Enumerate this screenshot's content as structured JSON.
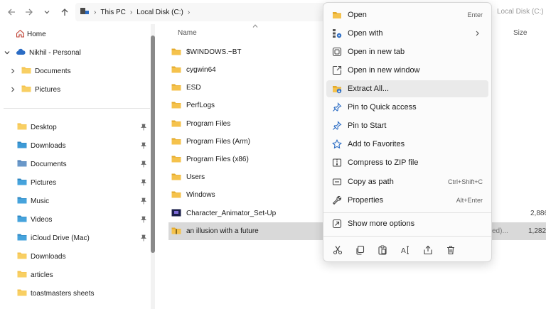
{
  "nav": {
    "breadcrumbs": [
      "This PC",
      "Local Disk (C:)"
    ],
    "address_ghost": "Local Disk (C:)"
  },
  "sidebar": {
    "items": [
      {
        "label": "Home"
      },
      {
        "label": "Nikhil - Personal"
      },
      {
        "label": "Documents"
      },
      {
        "label": "Pictures"
      },
      {
        "label": "Desktop"
      },
      {
        "label": "Downloads"
      },
      {
        "label": "Documents"
      },
      {
        "label": "Pictures"
      },
      {
        "label": "Music"
      },
      {
        "label": "Videos"
      },
      {
        "label": "iCloud Drive (Mac)"
      },
      {
        "label": "Downloads"
      },
      {
        "label": "articles"
      },
      {
        "label": "toastmasters sheets"
      }
    ]
  },
  "files": {
    "name_header": "Name",
    "size_header": "Size",
    "rows": [
      {
        "name": "$WINDOWS.~BT"
      },
      {
        "name": "cygwin64"
      },
      {
        "name": "ESD"
      },
      {
        "name": "PerfLogs"
      },
      {
        "name": "Program Files"
      },
      {
        "name": "Program Files (Arm)"
      },
      {
        "name": "Program Files (x86)"
      },
      {
        "name": "Users"
      },
      {
        "name": "Windows"
      },
      {
        "name": "Character_Animator_Set-Up",
        "size": "2,886"
      },
      {
        "name": "an illusion with a future",
        "extra": "ed)...",
        "size": "1,282"
      }
    ]
  },
  "menu": {
    "items": [
      {
        "label": "Open",
        "shortcut": "Enter",
        "icon": "folder-icon"
      },
      {
        "label": "Open with",
        "icon": "open-with-icon"
      },
      {
        "label": "Open in new tab",
        "icon": "new-tab-icon"
      },
      {
        "label": "Open in new window",
        "icon": "new-window-icon"
      },
      {
        "label": "Extract All...",
        "icon": "extract-icon"
      },
      {
        "label": "Pin to Quick access",
        "icon": "pin-icon"
      },
      {
        "label": "Pin to Start",
        "icon": "pin-icon"
      },
      {
        "label": "Add to Favorites",
        "icon": "star-icon"
      },
      {
        "label": "Compress to ZIP file",
        "icon": "zip-icon"
      },
      {
        "label": "Copy as path",
        "shortcut": "Ctrl+Shift+C",
        "icon": "copy-path-icon"
      },
      {
        "label": "Properties",
        "shortcut": "Alt+Enter",
        "icon": "wrench-icon"
      },
      {
        "label": "Show more options",
        "icon": "share-icon"
      }
    ]
  },
  "colors": {
    "folder": "#f5c24c",
    "folder_dark": "#e3a92a",
    "accent_blue": "#2b6cc4",
    "selected_row": "#d9d9d9"
  }
}
